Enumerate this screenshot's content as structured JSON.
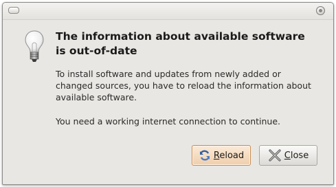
{
  "window": {
    "menu_icon": "window-menu-icon",
    "close_icon": "window-close-icon"
  },
  "dialog": {
    "icon": "lightbulb-icon",
    "title_line1": "The information about available software",
    "title_line2": "is out-of-date",
    "body_line1": "To install software and updates from newly added or",
    "body_line2": "changed sources, you have to reload the information about",
    "body_line3": "available software.",
    "body_line4": "You need a working internet connection to continue."
  },
  "buttons": {
    "reload": {
      "mnemonic": "R",
      "rest": "eload",
      "icon": "reload-icon"
    },
    "close": {
      "mnemonic": "C",
      "rest": "lose",
      "icon": "close-x-icon"
    }
  },
  "colors": {
    "dialog_bg": "#e9e7e3",
    "default_button_border": "#c88a4e",
    "default_button_bg": "#efcfac"
  }
}
